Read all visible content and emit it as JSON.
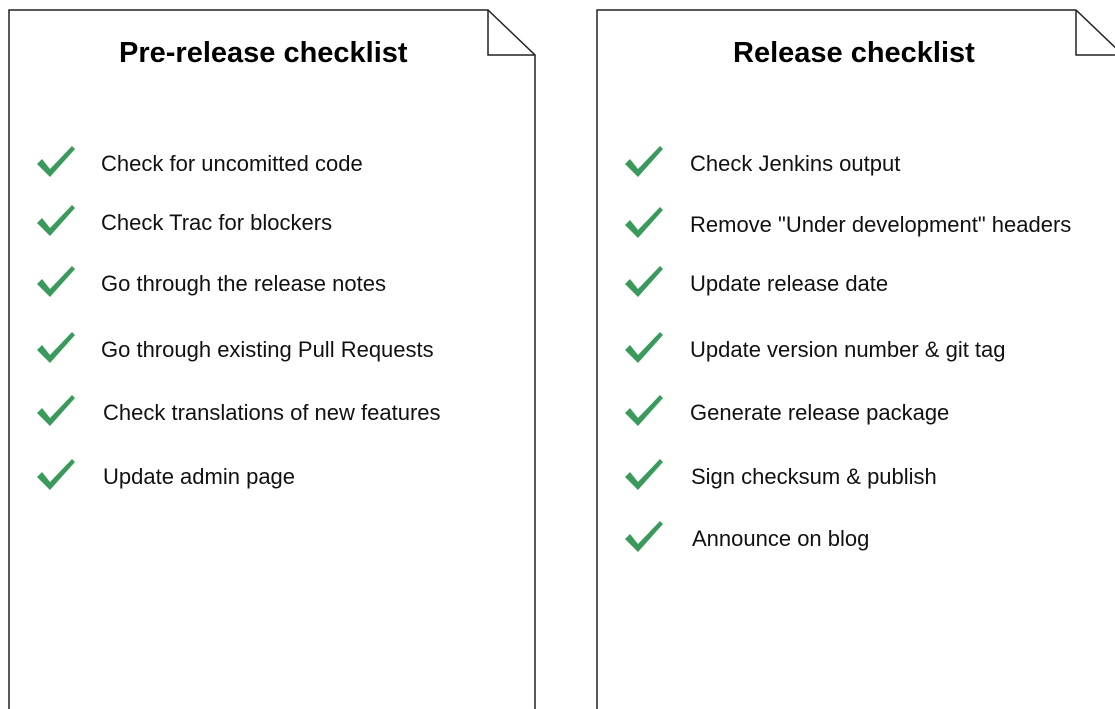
{
  "colors": {
    "check": "#3a9a5b",
    "outline": "#222222",
    "text": "#111111"
  },
  "icons": {
    "check": "checkmark-icon",
    "page": "folded-corner-document"
  },
  "pre_release": {
    "title": "Pre-release checklist",
    "items": [
      "Check for uncomitted code",
      "Check Trac for blockers",
      "Go through the release notes",
      "Go through existing Pull Requests",
      "Check translations of new features",
      "Update admin page"
    ]
  },
  "release": {
    "title": "Release checklist",
    "items": [
      "Check Jenkins output",
      "Remove \"Under development\" headers",
      "Update release date",
      "Update version number & git tag",
      "Generate release package",
      "Sign checksum & publish",
      "Announce on blog"
    ]
  }
}
